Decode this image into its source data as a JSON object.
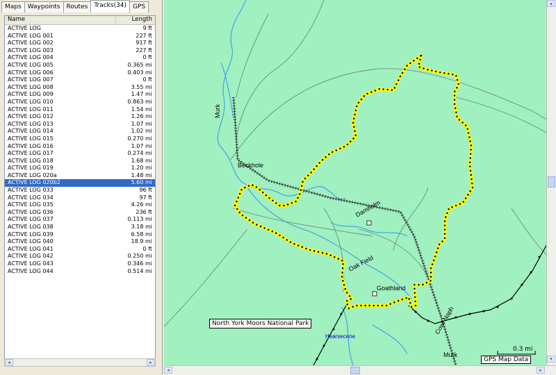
{
  "tabs": [
    "Maps",
    "Waypoints",
    "Routes",
    "Tracks(34)",
    "GPS"
  ],
  "list": {
    "columns": {
      "name": "Name",
      "length": "Length"
    },
    "rows": [
      {
        "name": "ACTIVE LOG",
        "len": "9 ft"
      },
      {
        "name": "ACTIVE LOG 001",
        "len": "227 ft"
      },
      {
        "name": "ACTIVE LOG 002",
        "len": "917 ft"
      },
      {
        "name": "ACTIVE LOG 003",
        "len": "227 ft"
      },
      {
        "name": "ACTIVE LOG 004",
        "len": "0 ft"
      },
      {
        "name": "ACTIVE LOG 005",
        "len": "0.365 mi"
      },
      {
        "name": "ACTIVE LOG 006",
        "len": "0.403 mi"
      },
      {
        "name": "ACTIVE LOG 007",
        "len": "0 ft"
      },
      {
        "name": "ACTIVE LOG 008",
        "len": "3.55 mi"
      },
      {
        "name": "ACTIVE LOG 009",
        "len": "1.47 mi"
      },
      {
        "name": "ACTIVE LOG 010",
        "len": "0.863 mi"
      },
      {
        "name": "ACTIVE LOG 011",
        "len": "1.54 mi"
      },
      {
        "name": "ACTIVE LOG 012",
        "len": "1.26 mi"
      },
      {
        "name": "ACTIVE LOG 013",
        "len": "1.07 mi"
      },
      {
        "name": "ACTIVE LOG 014",
        "len": "1.02 mi"
      },
      {
        "name": "ACTIVE LOG 015",
        "len": "0.270 mi"
      },
      {
        "name": "ACTIVE LOG 016",
        "len": "1.07 mi"
      },
      {
        "name": "ACTIVE LOG 017",
        "len": "0.274 mi"
      },
      {
        "name": "ACTIVE LOG 018",
        "len": "1.68 mi"
      },
      {
        "name": "ACTIVE LOG 019",
        "len": "1.20 mi"
      },
      {
        "name": "ACTIVE LOG 020a",
        "len": "1.48 mi"
      },
      {
        "name": "ACTIVE LOG 020b2",
        "len": "5.60 mi",
        "selected": true
      },
      {
        "name": "ACTIVE LOG 033",
        "len": "96 ft"
      },
      {
        "name": "ACTIVE LOG 034",
        "len": "97 ft"
      },
      {
        "name": "ACTIVE LOG 035",
        "len": "4.26 mi"
      },
      {
        "name": "ACTIVE LOG 036",
        "len": "236 ft"
      },
      {
        "name": "ACTIVE LOG 037",
        "len": "0.113 mi"
      },
      {
        "name": "ACTIVE LOG 038",
        "len": "3.18 mi"
      },
      {
        "name": "ACTIVE LOG 039",
        "len": "6.58 mi"
      },
      {
        "name": "ACTIVE LOG 040",
        "len": "18.9 mi"
      },
      {
        "name": "ACTIVE LOG 041",
        "len": "0 ft"
      },
      {
        "name": "ACTIVE LOG 042",
        "len": "0.250 mi"
      },
      {
        "name": "ACTIVE LOG 043",
        "len": "0.346 mi"
      },
      {
        "name": "ACTIVE LOG 044",
        "len": "0.514 mi"
      }
    ]
  },
  "map": {
    "labels": {
      "beckhole": "Beckhole",
      "murk_top": "Murk",
      "darnholm": "Darnholm",
      "oak_field": "Oak Field",
      "goathland": "Goathland",
      "murk_bottom": "Murk",
      "hearsecene": "Hearsecene",
      "cowl_naph": "Cowl Naph"
    },
    "park_label": "North York Moors National Park",
    "scale": "0.3 mi",
    "data_label": "GPS Map Data",
    "colors": {
      "background": "#a0f0c0",
      "track": "#ffff00",
      "water": "#4aa8e8"
    }
  }
}
